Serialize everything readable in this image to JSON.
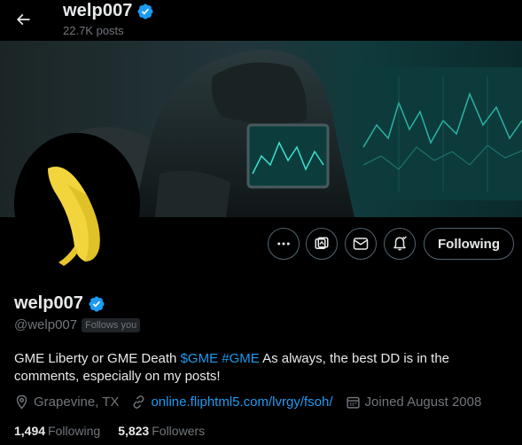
{
  "header": {
    "display_name": "welp007",
    "post_count": "22.7K posts"
  },
  "profile": {
    "display_name": "welp007",
    "handle": "@welp007",
    "follows_you": "Follows you",
    "bio_text_1": "GME Liberty or GME Death ",
    "bio_cashtag": "$GME",
    "bio_hashtag": "#GME",
    "bio_text_2": " As always, the best DD is in the comments, especially on my posts!",
    "location": "Grapevine, TX",
    "website": "online.fliphtml5.com/lvrgy/fsoh/",
    "joined": "Joined August 2008",
    "following_count": "1,494",
    "following_label": "Following",
    "followers_count": "5,823",
    "followers_label": "Followers"
  },
  "actions": {
    "following_button": "Following"
  },
  "icons": {
    "back": "arrow-left-icon",
    "verified": "verified-badge-icon",
    "more": "more-icon",
    "grok": "grok-icon",
    "message": "message-icon",
    "notifications": "bell-icon",
    "location": "location-pin-icon",
    "link": "link-icon",
    "calendar": "calendar-icon"
  },
  "colors": {
    "background": "#000000",
    "text_primary": "#e7e9ea",
    "text_secondary": "#71767b",
    "accent": "#1d9bf0",
    "border": "#536471",
    "avatar_banana": "#f2d53c"
  }
}
